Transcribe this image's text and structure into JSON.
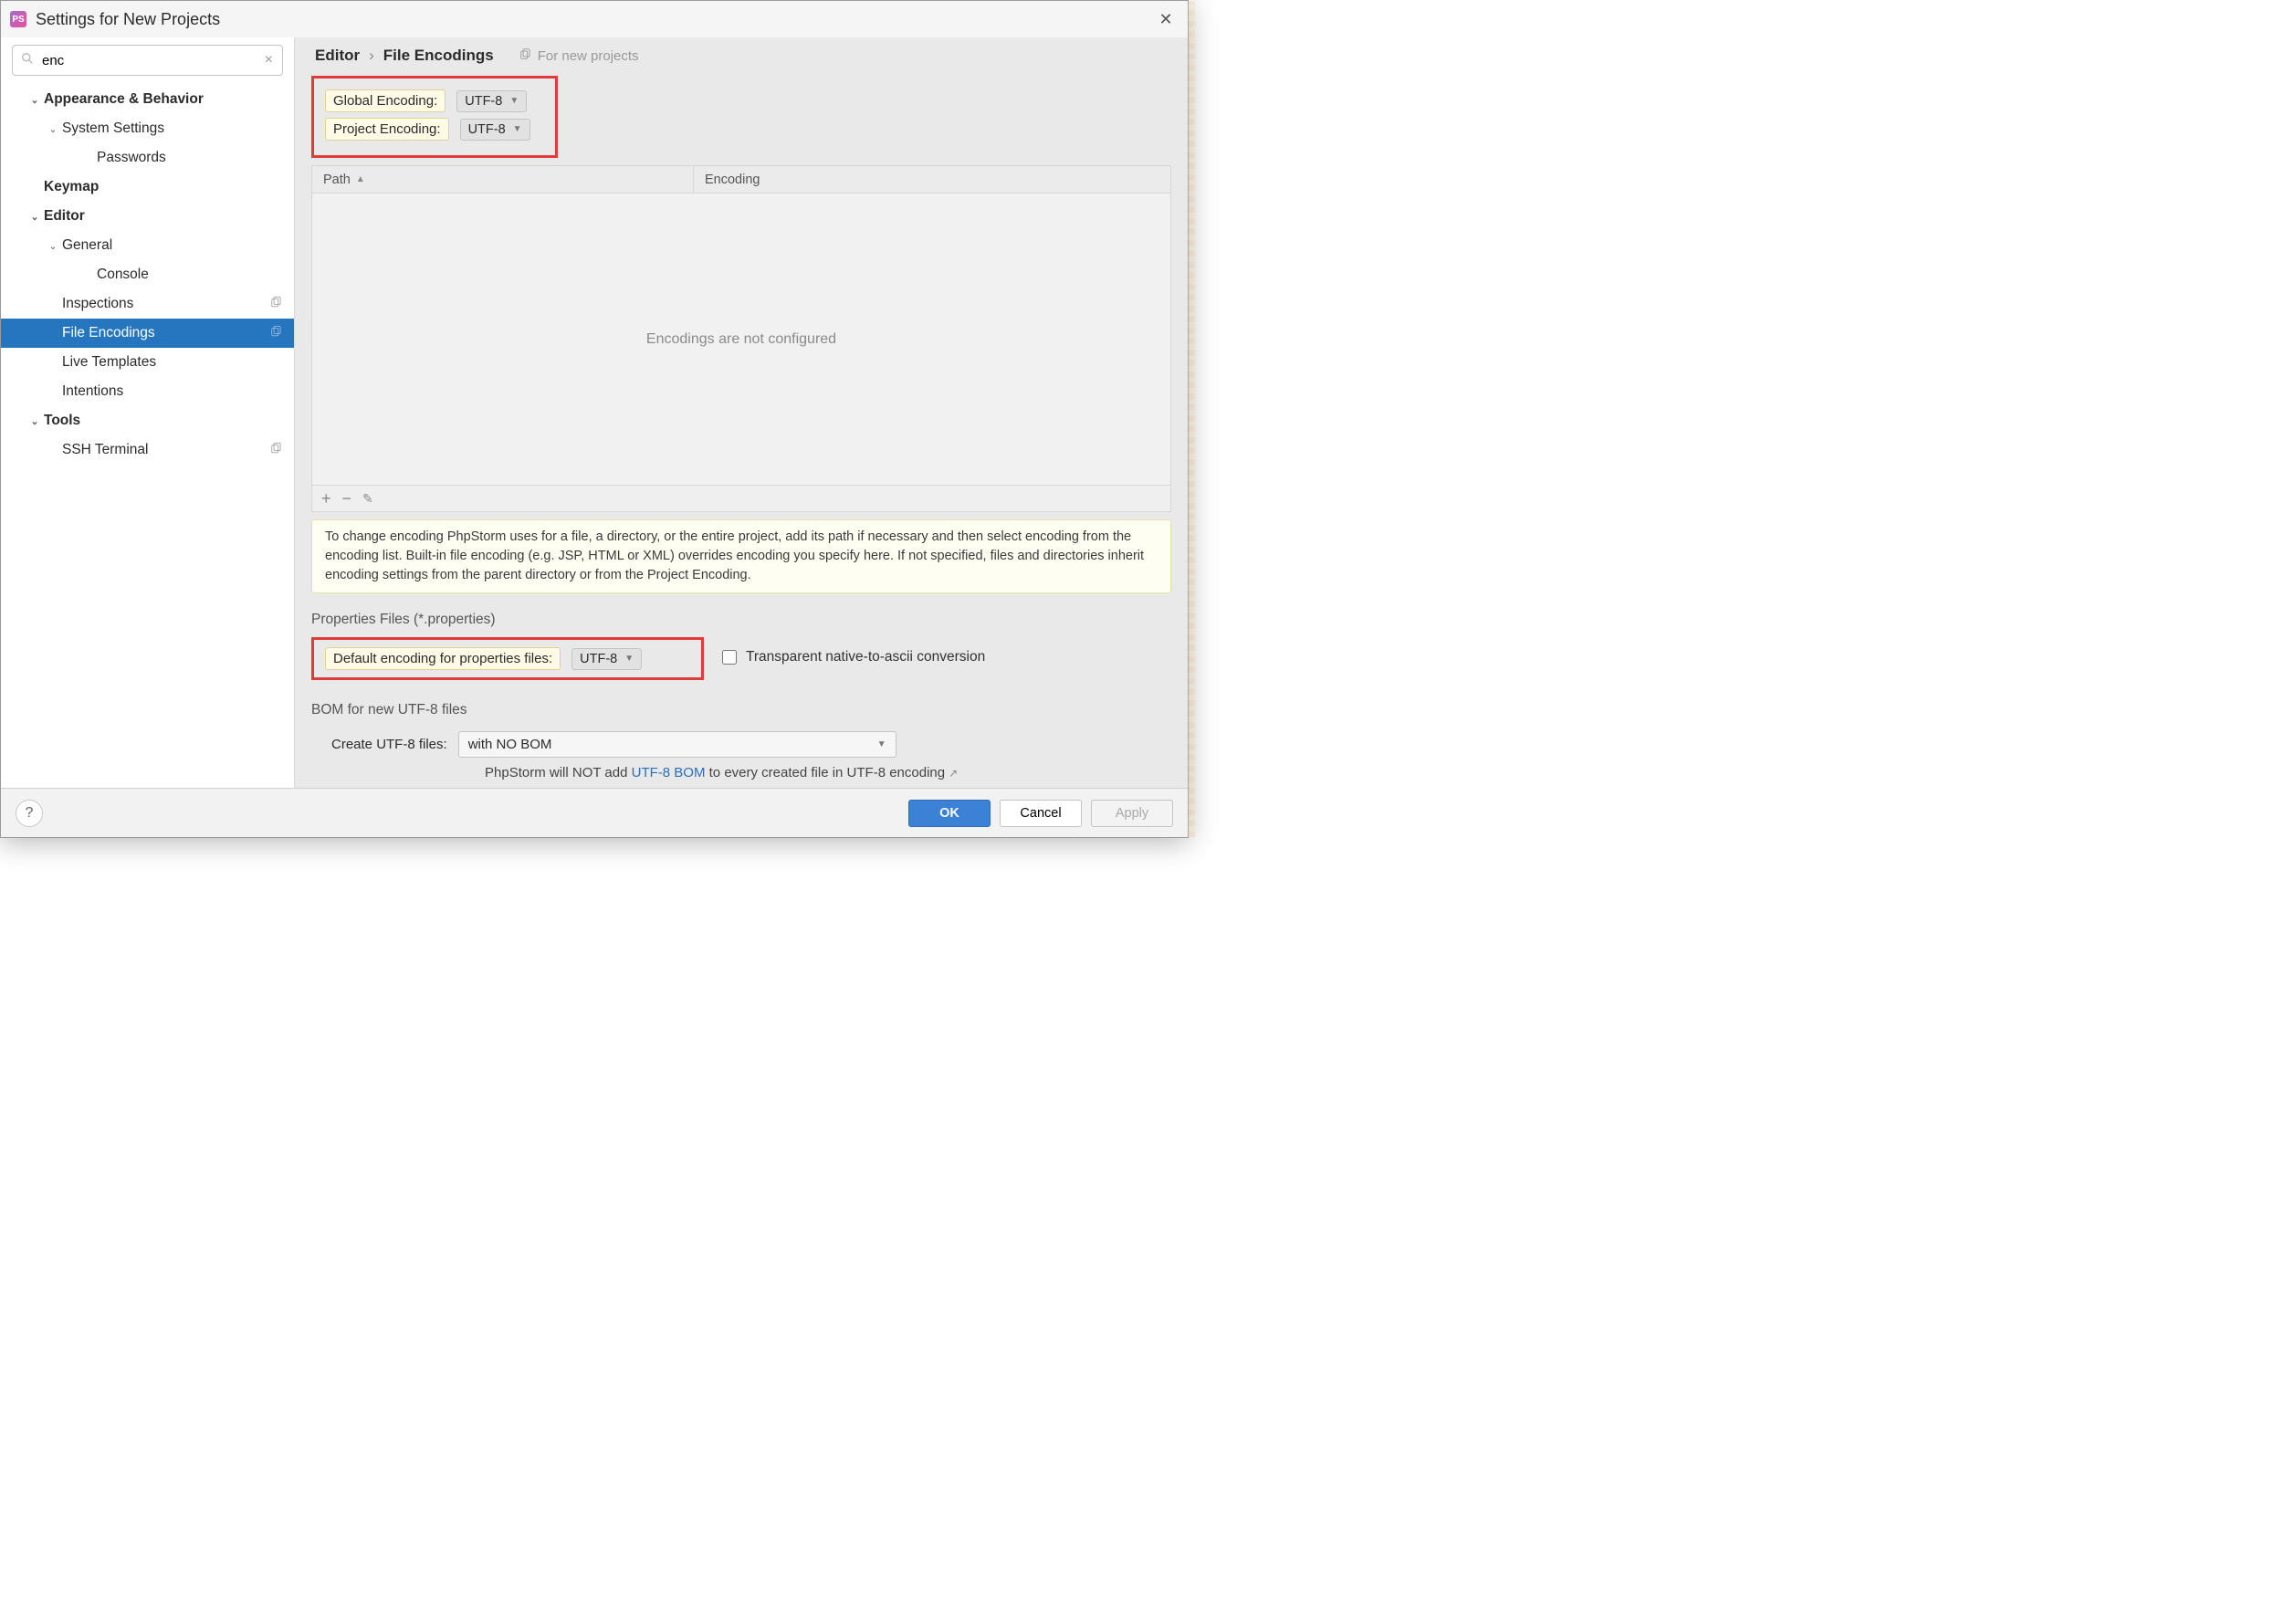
{
  "window": {
    "title": "Settings for New Projects"
  },
  "search": {
    "value": "enc"
  },
  "tree": {
    "items": [
      {
        "label": "Appearance & Behavior",
        "indent": 0,
        "bold": true,
        "chevron": "down"
      },
      {
        "label": "System Settings",
        "indent": 1,
        "bold": false,
        "chevron": "down"
      },
      {
        "label": "Passwords",
        "indent": 3,
        "bold": false
      },
      {
        "label": "Keymap",
        "indent": 0,
        "bold": true
      },
      {
        "label": "Editor",
        "indent": 0,
        "bold": true,
        "chevron": "down"
      },
      {
        "label": "General",
        "indent": 1,
        "bold": false,
        "chevron": "down"
      },
      {
        "label": "Console",
        "indent": 3,
        "bold": false
      },
      {
        "label": "Inspections",
        "indent": 1,
        "bold": false,
        "copy": true
      },
      {
        "label": "File Encodings",
        "indent": 1,
        "bold": false,
        "selected": true,
        "copy": true
      },
      {
        "label": "Live Templates",
        "indent": 1,
        "bold": false
      },
      {
        "label": "Intentions",
        "indent": 1,
        "bold": false
      },
      {
        "label": "Tools",
        "indent": 0,
        "bold": true,
        "chevron": "down"
      },
      {
        "label": "SSH Terminal",
        "indent": 1,
        "bold": false,
        "copy": true
      }
    ]
  },
  "breadcrumb": {
    "root": "Editor",
    "leaf": "File Encodings",
    "hint": "For new projects"
  },
  "fields": {
    "global_label": "Global Encoding:",
    "global_value": "UTF-8",
    "project_label": "Project Encoding:",
    "project_value": "UTF-8"
  },
  "table": {
    "col_path": "Path",
    "col_encoding": "Encoding",
    "empty_text": "Encodings are not configured"
  },
  "toolbar": {
    "add": "+",
    "remove": "−",
    "edit": "✎"
  },
  "info_text": "To change encoding PhpStorm uses for a file, a directory, or the entire project, add its path if necessary and then select encoding from the encoding list. Built-in file encoding (e.g. JSP, HTML or XML) overrides encoding you specify here. If not specified, files and directories inherit encoding settings from the parent directory or from the Project Encoding.",
  "properties": {
    "section_title": "Properties Files (*.properties)",
    "default_label": "Default encoding for properties files:",
    "default_value": "UTF-8",
    "transparent_label": "Transparent native-to-ascii conversion"
  },
  "bom": {
    "section_title": "BOM for new UTF-8 files",
    "create_label": "Create UTF-8 files:",
    "create_value": "with NO BOM",
    "note_prefix": "PhpStorm will NOT add ",
    "note_link": "UTF-8 BOM",
    "note_suffix": " to every created file in UTF-8 encoding"
  },
  "footer": {
    "ok": "OK",
    "cancel": "Cancel",
    "apply": "Apply"
  }
}
